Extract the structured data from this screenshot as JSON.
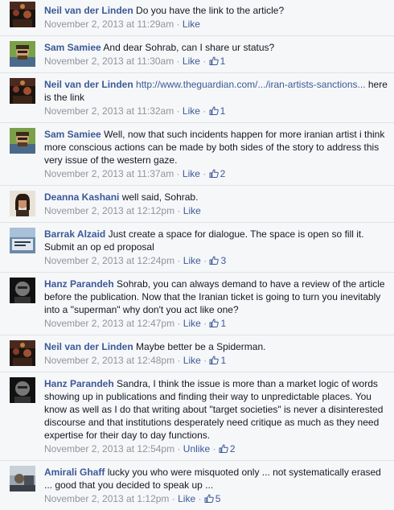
{
  "colors": {
    "link": "#3b5998",
    "meta": "#90949c",
    "text": "#141823",
    "bg": "#f6f7f9"
  },
  "comments": [
    {
      "name": "Neil van der Linden",
      "text": "Do you have the link to the article?",
      "time": "November 2, 2013 at 11:29am",
      "action": "Like",
      "likes": "",
      "avatar": "neil"
    },
    {
      "name": "Sam Samiee",
      "text": "And dear Sohrab, can I share ur status?",
      "time": "November 2, 2013 at 11:30am",
      "action": "Like",
      "likes": "1",
      "avatar": "sam"
    },
    {
      "name": "Neil van der Linden",
      "link": "http://www.theguardian.com/.../iran-artists-sanctions...",
      "text": "here is the link",
      "time": "November 2, 2013 at 11:32am",
      "action": "Like",
      "likes": "1",
      "avatar": "neil"
    },
    {
      "name": "Sam Samiee",
      "text": "Well, now that such incidents happen for more iranian artist i think more conscious actions can be made by both sides of the story to address this very issue of the western gaze.",
      "time": "November 2, 2013 at 11:37am",
      "action": "Like",
      "likes": "2",
      "avatar": "sam"
    },
    {
      "name": "Deanna Kashani",
      "text": "well said, Sohrab.",
      "time": "November 2, 2013 at 12:12pm",
      "action": "Like",
      "likes": "",
      "avatar": "deanna"
    },
    {
      "name": "Barrak Alzaid",
      "text": "Just create a space for dialogue. The space is open so fill it. Submit an op ed proposal",
      "time": "November 2, 2013 at 12:24pm",
      "action": "Like",
      "likes": "3",
      "avatar": "barrak"
    },
    {
      "name": "Hanz Parandeh",
      "text": "Sohrab, you can always demand to have a review of the article before the publication. Now that the Iranian ticket is going to turn you inevitably into a \"superman\" why don't you act like one?",
      "time": "November 2, 2013 at 12:47pm",
      "action": "Like",
      "likes": "1",
      "avatar": "hanz"
    },
    {
      "name": "Neil van der Linden",
      "text": "Maybe better be a Spiderman.",
      "time": "November 2, 2013 at 12:48pm",
      "action": "Like",
      "likes": "1",
      "avatar": "neil"
    },
    {
      "name": "Hanz Parandeh",
      "text": "Sandra, I think the issue is more than a market logic of words showing up in publications and finding their way to unpredictable places. You know as well as I do that writing about \"target societies\" is never a disinterested discourse and that institutions desperately need critique as much as they need expertise for their day to day functions.",
      "time": "November 2, 2013 at 12:54pm",
      "action": "Unlike",
      "likes": "2",
      "avatar": "hanz"
    },
    {
      "name": "Amirali Ghaff",
      "text": "lucky you who were misquoted only ... not systematically erased ... good that you decided to speak up ...",
      "time": "November 2, 2013 at 1:12pm",
      "action": "Like",
      "likes": "5",
      "avatar": "amirali"
    }
  ]
}
